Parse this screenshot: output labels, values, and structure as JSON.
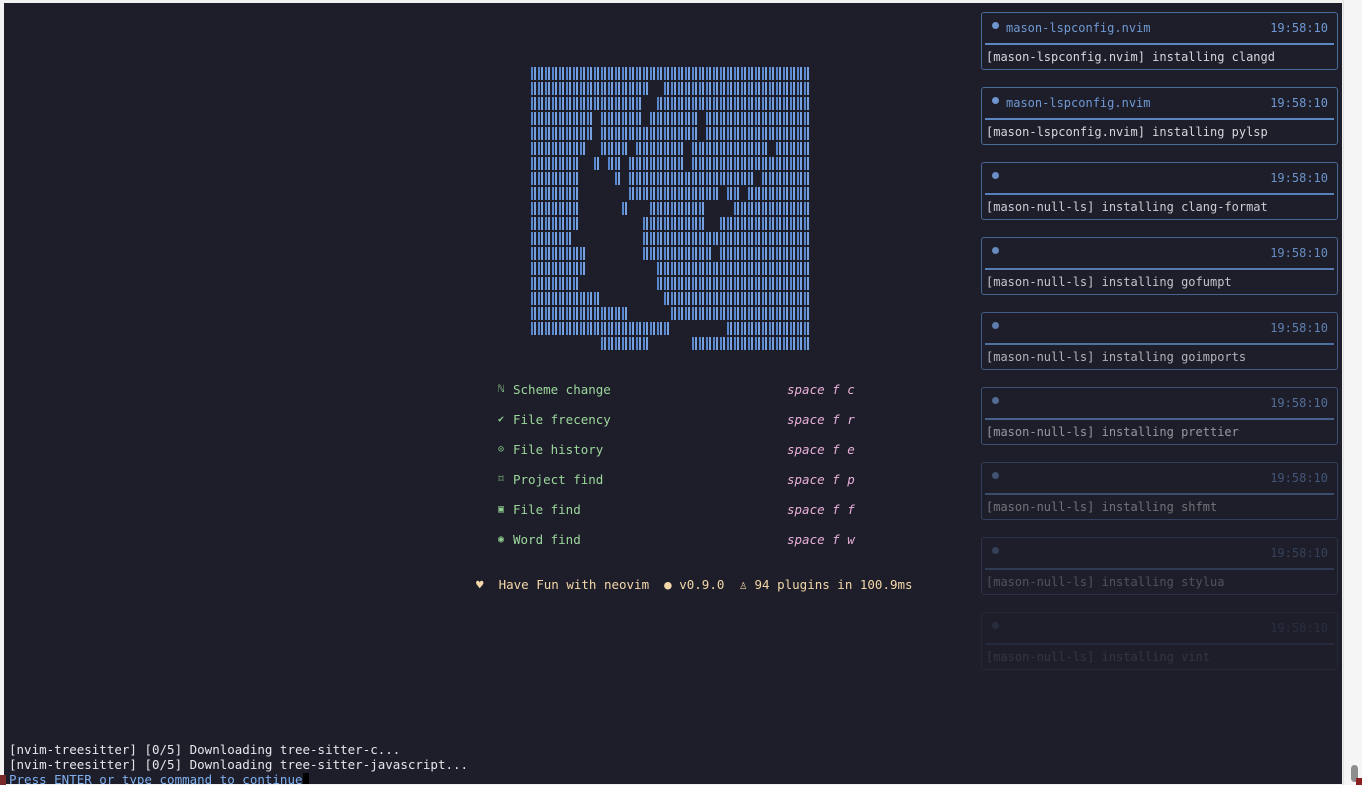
{
  "art": {
    "rows": [
      "########################################",
      "#################  #####################",
      "################  ######################",
      "######### ###### ####### ###############",
      "######### ############## ###############",
      "########  #### ####### ########### #####",
      "#######  # ## ######## #################",
      "#######     # ################## #######",
      "#######       ############# ## #########",
      "#######      #   ########    ###########",
      "#######         #########  #############",
      "######          ########################",
      "########        ########## #############",
      "########          ######################",
      "#######           ######################",
      "##########         #####################",
      "##############      ####################",
      "####################        ############",
      "          #######      #################"
    ]
  },
  "menu": [
    {
      "icon": "ℕ",
      "icon_name": "scheme-icon",
      "label": "Scheme change",
      "key": "space f c"
    },
    {
      "icon": "✔",
      "icon_name": "rocket-icon",
      "label": "File frecency",
      "key": "space f r"
    },
    {
      "icon": "⊙",
      "icon_name": "history-icon",
      "label": "File history",
      "key": "space f e"
    },
    {
      "icon": "⌑",
      "icon_name": "bookmark-icon",
      "label": "Project find",
      "key": "space f p"
    },
    {
      "icon": "▣",
      "icon_name": "file-icon",
      "label": "File find",
      "key": "space f f"
    },
    {
      "icon": "◉",
      "icon_name": "word-icon",
      "label": "Word find",
      "key": "space f w"
    }
  ],
  "footer": {
    "heart": "♥",
    "tagline": "Have Fun with neovim",
    "version_icon": "●",
    "version": "v0.9.0",
    "plugins_icon": "♙",
    "plugins": "94 plugins in 100.9ms"
  },
  "notifications": [
    {
      "title": "mason-lspconfig.nvim",
      "time": "19:58:10",
      "message": "[mason-lspconfig.nvim] installing clangd",
      "opacity": 1.0
    },
    {
      "title": "mason-lspconfig.nvim",
      "time": "19:58:10",
      "message": "[mason-lspconfig.nvim] installing pylsp",
      "opacity": 1.0
    },
    {
      "title": "",
      "time": "19:58:10",
      "message": "[mason-null-ls] installing clang-format",
      "opacity": 0.95
    },
    {
      "title": "",
      "time": "19:58:10",
      "message": "[mason-null-ls] installing gofumpt",
      "opacity": 0.9
    },
    {
      "title": "",
      "time": "19:58:10",
      "message": "[mason-null-ls] installing goimports",
      "opacity": 0.8
    },
    {
      "title": "",
      "time": "19:58:10",
      "message": "[mason-null-ls] installing prettier",
      "opacity": 0.65
    },
    {
      "title": "",
      "time": "19:58:10",
      "message": "[mason-null-ls] installing shfmt",
      "opacity": 0.45
    },
    {
      "title": "",
      "time": "19:58:10",
      "message": "[mason-null-ls] installing stylua",
      "opacity": 0.28
    },
    {
      "title": "",
      "time": "19:58:10",
      "message": "[mason-null-ls] installing vint",
      "opacity": 0.12
    }
  ],
  "messages": [
    "[nvim-treesitter] [0/5] Downloading tree-sitter-c...",
    "[nvim-treesitter] [0/5] Downloading tree-sitter-javascript..."
  ],
  "prompt": "Press ENTER or type command to continue"
}
